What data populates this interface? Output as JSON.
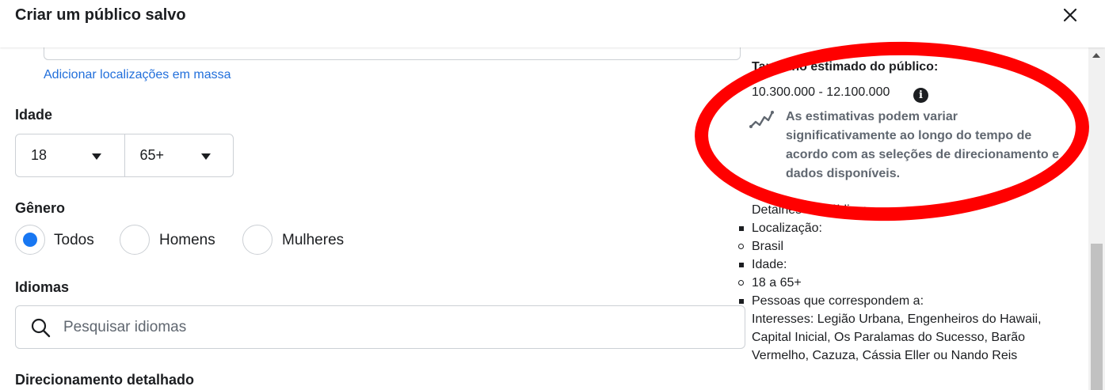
{
  "header": {
    "title": "Criar um público salvo",
    "close_icon": "close-icon"
  },
  "location": {
    "bulk_link": "Adicionar localizações em massa"
  },
  "age": {
    "label": "Idade",
    "min": "18",
    "max": "65+"
  },
  "gender": {
    "label": "Gênero",
    "options": [
      {
        "label": "Todos",
        "checked": true
      },
      {
        "label": "Homens",
        "checked": false
      },
      {
        "label": "Mulheres",
        "checked": false
      }
    ]
  },
  "languages": {
    "label": "Idiomas",
    "placeholder": "Pesquisar idiomas"
  },
  "detailed": {
    "label": "Direcionamento detalhado"
  },
  "audience": {
    "title": "Tamanho estimado do público:",
    "range": "10.300.000 - 12.100.000",
    "note": "As estimativas podem variar significativamente ao longo do tempo de acordo com as seleções de direcionamento e dados disponíveis.",
    "details_title": "Detalhes do público:",
    "details": [
      {
        "type": "square",
        "text": "Localização:"
      },
      {
        "type": "circle",
        "text": "Brasil"
      },
      {
        "type": "square",
        "text": "Idade:"
      },
      {
        "type": "circle",
        "text": "18 a 65+"
      },
      {
        "type": "square",
        "text": "Pessoas que correspondem a:"
      },
      {
        "type": "none",
        "text": "Interesses: Legião Urbana, Engenheiros do Hawaii, Capital Inicial, Os Paralamas do Sucesso, Barão Vermelho, Cazuza, Cássia Eller ou Nando Reis"
      }
    ]
  },
  "colors": {
    "accent": "#1877f2",
    "link": "#216fdb",
    "annotation": "#ff0000"
  }
}
